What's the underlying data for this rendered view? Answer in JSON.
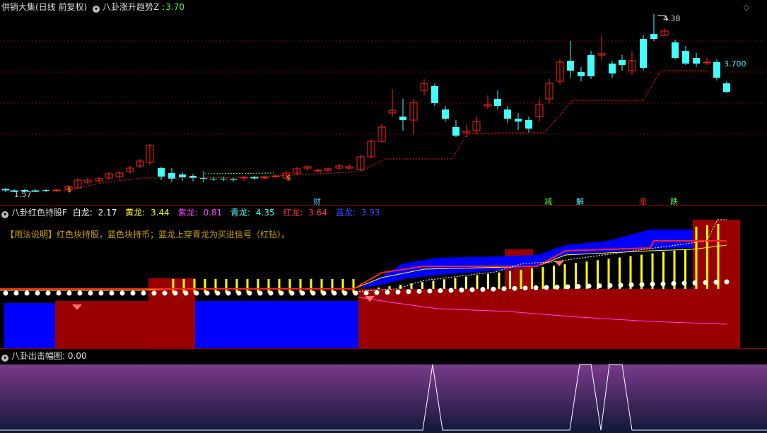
{
  "main_panel": {
    "title": "供销大集(日线 前复权)",
    "indicator": "八卦涨升趋势Z",
    "indicator_value": "3.70",
    "high_label": "4.38",
    "low_label": "1.57",
    "current_label": "3.700",
    "signal_labels": [
      "财",
      "减",
      "解",
      "涨",
      "跌"
    ],
    "corner_icon": "diamond-icon"
  },
  "mid_panel": {
    "title": "八卦红色持股F",
    "items": [
      {
        "name": "白龙:",
        "value": "2.17",
        "color": "#ffffff"
      },
      {
        "name": "黄龙:",
        "value": "3.44",
        "color": "#ffff00"
      },
      {
        "name": "紫龙:",
        "value": "0.81",
        "color": "#ff40ff"
      },
      {
        "name": "青龙:",
        "value": "4.35",
        "color": "#40ffff"
      },
      {
        "name": "红龙:",
        "value": "3.64",
        "color": "#ff3030"
      },
      {
        "name": "蓝龙:",
        "value": "3.93",
        "color": "#3040ff"
      }
    ],
    "note": "【用法说明】红色块持股，蓝色块持币；蓝龙上穿青龙为买进信号（红钻）。"
  },
  "bottom_panel": {
    "title": "八卦出击幅图",
    "value": ": 0.00"
  },
  "colors": {
    "up": "#ff2020",
    "down": "#40ffff",
    "grid": "#8b0000",
    "hold": "#9b0000",
    "cash": "#0000ff"
  }
}
